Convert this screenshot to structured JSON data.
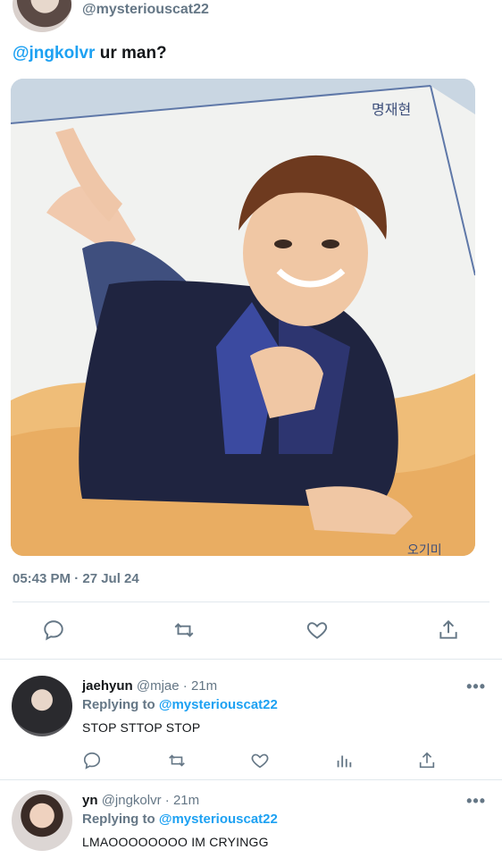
{
  "tweet": {
    "author_handle": "@mysteriouscat22",
    "mention": "@jngkolvr",
    "text": " ur man?",
    "timestamp": "05:43 PM · 27 Jul 24",
    "media_caption_top": "명재현",
    "media_caption_bottom": "오기미"
  },
  "replies": [
    {
      "name": "jaehyun",
      "handle": "@mjae",
      "time": "· 21m",
      "replying_label": "Replying to",
      "replying_to": "@mysteriouscat22",
      "text": "STOP STTOP STOP",
      "more": "•••"
    },
    {
      "name": "yn",
      "handle": "@jngkolvr",
      "time": "· 21m",
      "replying_label": "Replying to",
      "replying_to": "@mysteriouscat22",
      "text": "LMAOOOOOOOO IM CRYINGG",
      "more": "•••"
    }
  ],
  "colors": {
    "accent": "#1da1f2",
    "secondary_text": "#657786",
    "divider": "#e1e8ed"
  },
  "icons": [
    "reply-icon",
    "retweet-icon",
    "like-icon",
    "share-icon",
    "analytics-icon",
    "more-icon"
  ]
}
